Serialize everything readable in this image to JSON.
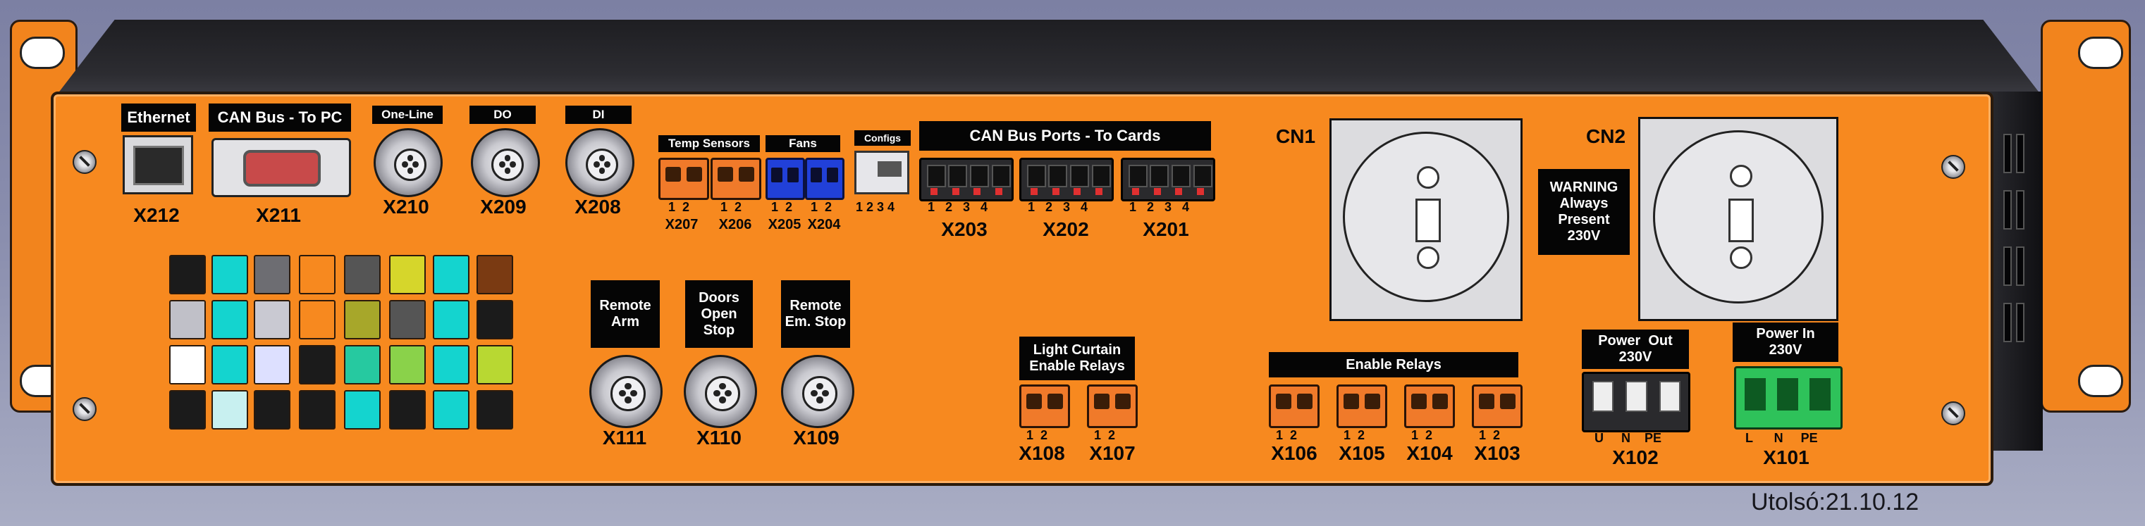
{
  "colors": {
    "panel": "#f7891f",
    "label_bg": "#050505",
    "label_text": "#ffffff",
    "terminal_orange": "#f07a2a",
    "terminal_blue": "#2140d8",
    "terminal_green": "#2ec25a"
  },
  "labels": {
    "ethernet": "Ethernet",
    "can_pc": "CAN Bus - To PC",
    "one_line": "One-Line",
    "do": "DO",
    "di": "DI",
    "temp_sensors": "Temp Sensors",
    "fans": "Fans",
    "configs": "Configs",
    "can_cards": "CAN Bus Ports - To Cards",
    "cn1": "CN1",
    "cn2": "CN2",
    "warning": "WARNING Always Present 230V",
    "remote_arm": "Remote Arm",
    "doors": "Doors Open Stop",
    "remote_em": "Remote Em. Stop",
    "light_curtain": "Light Curtain Enable Relays",
    "enable_relays": "Enable Relays",
    "power_out": "Power  Out 230V",
    "power_in": "Power In 230V",
    "footer": "Utolsó:21.10.12"
  },
  "ports": {
    "x212": "X212",
    "x211": "X211",
    "x210": "X210",
    "x209": "X209",
    "x208": "X208",
    "x207": "X207",
    "x206": "X206",
    "x205": "X205",
    "x204": "X204",
    "x203": "X203",
    "x202": "X202",
    "x201": "X201",
    "x111": "X111",
    "x110": "X110",
    "x109": "X109",
    "x108": "X108",
    "x107": "X107",
    "x106": "X106",
    "x105": "X105",
    "x104": "X104",
    "x103": "X103",
    "x102": "X102",
    "x101": "X101"
  },
  "pins": {
    "two": "1  2",
    "four": "1   2   3   4",
    "configs": "1 2 3 4",
    "power_out": "U     N    PE",
    "power_in": "L      N     PE"
  }
}
